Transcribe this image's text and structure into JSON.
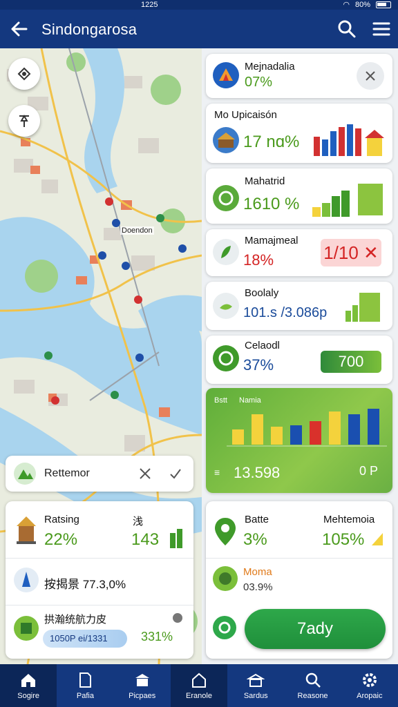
{
  "status": {
    "time": "1225",
    "battery": "80%"
  },
  "appbar": {
    "title": "Sindongarosa"
  },
  "map": {
    "place_label": "Doendon"
  },
  "cards": [
    {
      "title": "Mejnadalia",
      "value": "07%",
      "value_color": "green"
    },
    {
      "title": "Mo Upicaisón",
      "value": "17 nɑ%",
      "value_color": "green"
    },
    {
      "title": "Mahatrid",
      "value": "1610 %",
      "value_color": "green"
    },
    {
      "title": "Mamajmeal",
      "value": "18%",
      "value_color": "red",
      "badge": "1/10 ✕"
    },
    {
      "title": "Boolaly",
      "value": "101.s /3.086p",
      "value_color": "blue"
    },
    {
      "title": "Celaodl",
      "value": "37%",
      "value_color": "blue",
      "badge": "700"
    }
  ],
  "chart": {
    "legend_left": "Bstt",
    "legend_right": "Namia",
    "bottom_left": "13.598",
    "bottom_right": "0 P",
    "chart_data": {
      "type": "bar",
      "values": [
        22,
        44,
        26,
        28,
        34,
        48,
        44,
        52
      ],
      "colors": [
        "#f4d23c",
        "#f4d23c",
        "#f4d23c",
        "#1a4fb0",
        "#d9312b",
        "#f4d23c",
        "#1a4fb0",
        "#1a4fb0"
      ]
    }
  },
  "search_bar": {
    "label": "Rettemor"
  },
  "left_panel": {
    "row1_title": "Ratsing",
    "row1_value": "22%",
    "row1_right_title": "浅",
    "row1_right_value": "143",
    "row2_text": "按揭景 77.3,0%",
    "row3_title": "拱瀚统航力皮",
    "row3_pill": "1050P ei/1331",
    "row3_value": "331%"
  },
  "right_panel": {
    "left_title": "Batte",
    "left_value": "3%",
    "right_title": "Mehtemoia",
    "right_value": "105%",
    "row2_title": "Moma",
    "row2_value": "03.9%"
  },
  "ready_button": "7ady",
  "nav": [
    {
      "label": "Sogire",
      "icon": "home-icon"
    },
    {
      "label": "Pafia",
      "icon": "document-icon"
    },
    {
      "label": "Picpaes",
      "icon": "store-icon"
    },
    {
      "label": "Eranole",
      "icon": "house-icon"
    },
    {
      "label": "Sardus",
      "icon": "building-icon"
    },
    {
      "label": "Reasone",
      "icon": "search-icon"
    },
    {
      "label": "Aropaic",
      "icon": "settings-icon"
    }
  ]
}
